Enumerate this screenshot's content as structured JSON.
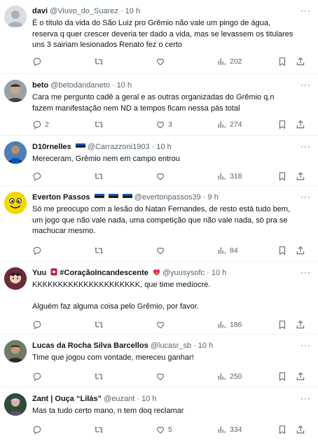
{
  "tweets": [
    {
      "name": "davi",
      "handle": "@Viuvo_do_Suarez",
      "time": "· 10 h",
      "text": "É o título da vida do São Luiz pro Grêmio não vale um pingo de água,\nreserva q quer crescer deveria ter dado a vida, mas se levassem os titulares\nuns 3 sairiam lesionados Renato fez o certo",
      "replies": "",
      "retweets": "",
      "likes": "",
      "views": "202",
      "avatar_color": "#d9dde1",
      "avatar_type": "default-avatar-icon"
    },
    {
      "name": "beto",
      "handle": "@betodandaneto",
      "time": "· 10 h",
      "text": "Cara me pergunto cadê a geral e as outras organizadas do Grêmio q.n\nfazem manifestação nem ND a tempos ficam nessa pás total",
      "replies": "2",
      "retweets": "",
      "likes": "3",
      "views": "274",
      "avatar_color": "#8a8f93"
    },
    {
      "name": "D10rnelles",
      "handle": "@Carrazzoni1903",
      "time": "· 10 h",
      "text": "Mereceram, Grêmio nem em campo entrou",
      "replies": "",
      "retweets": "",
      "likes": "",
      "views": "318",
      "avatar_color": "#3e6fa8",
      "flag_colors": [
        "#0a55b8",
        "#111111",
        "#ffffff"
      ]
    },
    {
      "name": "Everton Passos",
      "handle": "@evertonpassos39",
      "time": "· 9 h",
      "text": "Só me preocupo com a lesão do Natan Fernandes, de resto está tudo bem,\num jogo que não vale nada, uma competição que não vale nada, só pra se\nmachucar mesmo.",
      "replies": "",
      "retweets": "",
      "likes": "",
      "views": "84",
      "avatar_color": "#f5d800",
      "flag_colors": [
        "#0a55b8",
        "#111111",
        "#ffffff"
      ]
    },
    {
      "name": "Yuu",
      "title_part": "#CoraçãoIncandescente",
      "handle": "@yuusysofc",
      "time": "· 10 h",
      "text": "KKKKKKKKKKKKKKKKKKKKK, que time medíocre.\n\nAlguém faz alguma coisa pelo Grêmio, por favor.",
      "replies": "",
      "retweets": "",
      "likes": "",
      "views": "186",
      "avatar_color": "#6b2c3a"
    },
    {
      "name": "Lucas da Rocha Silva Barcellos",
      "handle": "@lucasr_sb",
      "time": "· 10 h",
      "text": "Time que jogou com vontade, mereceu ganhar!",
      "replies": "",
      "retweets": "",
      "likes": "",
      "views": "250",
      "avatar_color": "#5a4a3e"
    },
    {
      "name": "Zant | Ouça “Lilás”",
      "handle": "@euzant",
      "time": "· 10 h",
      "text": "Mas ta tudo certo mano, n tem doq reclamar",
      "replies": "",
      "retweets": "",
      "likes": "5",
      "views": "334",
      "avatar_color": "#3a5a3a"
    }
  ],
  "colors": {
    "text": "#0f1419",
    "secondary": "#536471",
    "border": "#eff3f4",
    "accent": "#1d9bf0"
  }
}
